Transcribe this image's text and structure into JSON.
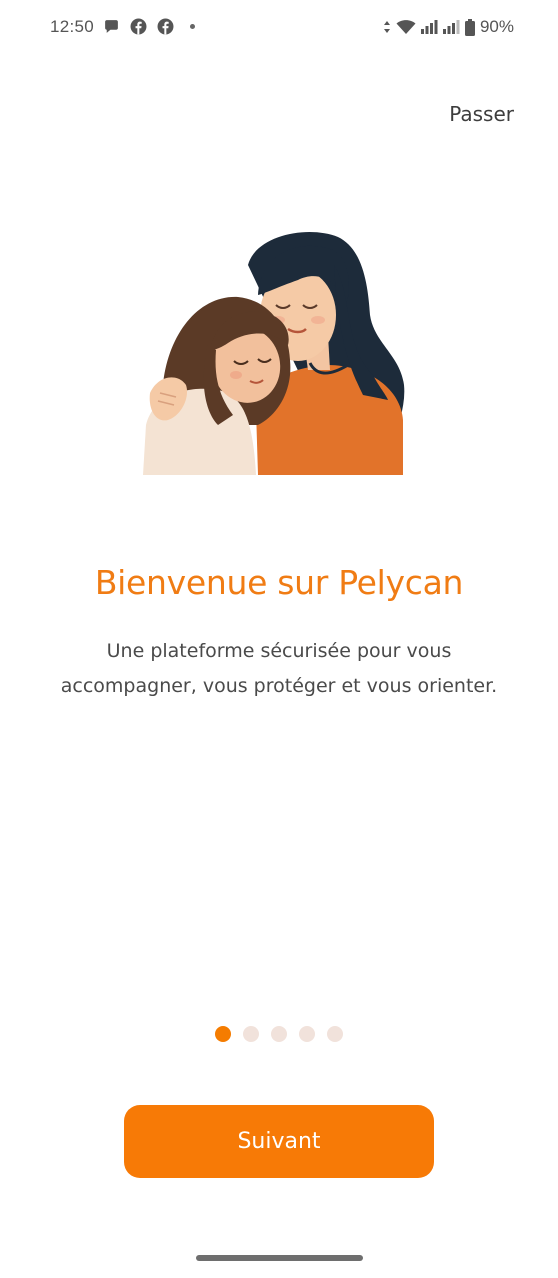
{
  "status_bar": {
    "time": "12:50",
    "left_icons": [
      "message-bubble-icon",
      "facebook-icon",
      "facebook-icon"
    ],
    "battery_percent": "90%"
  },
  "skip_label": "Passer",
  "onboarding": {
    "title": "Bienvenue sur Pelycan",
    "description": "Une plateforme sécurisée pour vous accompagner, vous protéger et vous orienter.",
    "page_count": 5,
    "current_page": 1
  },
  "next_label": "Suivant",
  "colors": {
    "accent": "#f77a06",
    "title": "#f07c14",
    "dot_inactive": "#f1e2db"
  }
}
